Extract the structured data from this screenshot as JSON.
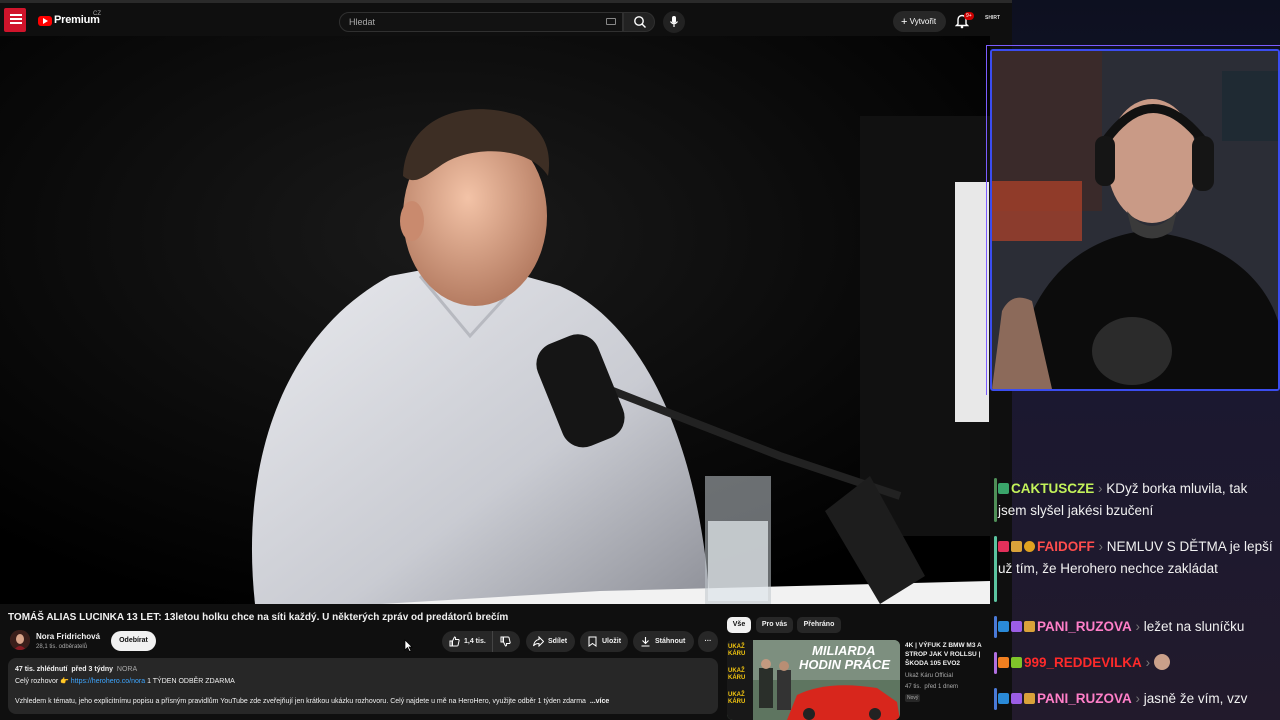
{
  "youtube": {
    "topbar": {
      "brand": "Premium",
      "region": "CZ",
      "search_placeholder": "Hledat",
      "create_label": "Vytvořit",
      "notifications_badge": "9+",
      "avatar_text": "SHIRT"
    },
    "video": {
      "title": "TOMÁŠ ALIAS LUCINKA 13 LET: 13letou holku chce na síti každý. U některých zpráv od predátorů brečím"
    },
    "channel": {
      "name": "Nora Fridrichová",
      "subscribers": "28,1 tis. odběratelů",
      "subscribe_label": "Odebírat"
    },
    "actions": {
      "likes": "1,4 tis.",
      "share": "Sdílet",
      "save": "Uložit",
      "download": "Stáhnout",
      "more": "···"
    },
    "description": {
      "views": "47 tis. zhlédnutí",
      "age": "před 3 týdny",
      "tag": "NORA",
      "line1_prefix": "Celý rozhovor 👉",
      "line1_link": "https://herohero.co/nora",
      "line1_suffix": " 1 TÝDEN ODBĚR ZDARMA",
      "line2": "Vzhledem k tématu, jeho explicitnímu popisu a přísným pravidlům YouTube zde zveřejňují jen krátkou ukázku rozhovoru. Celý najdete u mě na HeroHero, využijte odběr 1 týden zdarma",
      "more": "...více"
    },
    "chips": [
      "Vše",
      "Pro vás",
      "Přehráno"
    ],
    "recommendation": {
      "thumb_text_1": "MILIARDA",
      "thumb_text_2": "HODIN PRÁCE",
      "thumb_side": "UKAŽ KÁRU",
      "title": "4K | VÝFUK Z BMW M3 A STROP JAK V ROLLSU | ŠKODA 105 EVO2",
      "channel": "Ukaž Káru Official",
      "views": "47 tis.",
      "age": "před 1 dnem",
      "badge": "Nový"
    }
  },
  "chat": [
    {
      "user": "CAKTUSCZE",
      "user_color": "#c3f25a",
      "message": "KDyž borka mluvila, tak jsem slyšel jakési bzučení",
      "bar_color": "#4f8f57"
    },
    {
      "user": "FAIDOFF",
      "user_color": "#ff4d4d",
      "message": "NEMLUV S DĚTMA je lepší už tím, že Herohero nechce zakládat",
      "bar_color": "#5bc4a0"
    },
    {
      "user": "PANI_RUZOVA",
      "user_color": "#ff7fc8",
      "message": "ležet na sluníčku",
      "bar_color": "#4a7ad8"
    },
    {
      "user": "999_REDDEVILKA",
      "user_color": "#ff2a2a",
      "message": "",
      "bar_color": "#b06fe0"
    },
    {
      "user": "PANI_RUZOVA",
      "user_color": "#ff7fc8",
      "message": "jasně že vím, vzv",
      "bar_color": "#4a7ad8"
    }
  ]
}
